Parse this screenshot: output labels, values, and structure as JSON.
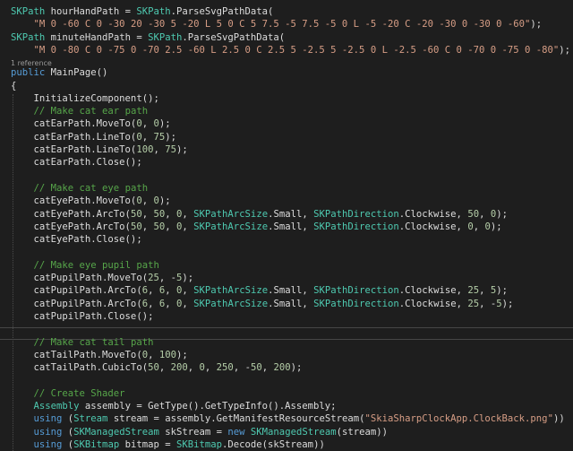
{
  "colors": {
    "background": "#1e1e1e",
    "text": "#dcdcdc",
    "type": "#4ec9b0",
    "keyword": "#569cd6",
    "string": "#d69d85",
    "comment": "#57a64a",
    "number": "#b5cea8"
  },
  "lines": [
    [
      [
        "t",
        "SKPath"
      ],
      [
        "p",
        " hourHandPath = "
      ],
      [
        "t",
        "SKPath"
      ],
      [
        "p",
        ".ParseSvgPathData("
      ]
    ],
    [
      [
        "p",
        "    "
      ],
      [
        "s",
        "\"M 0 -60 C 0 -30 20 -30 5 -20 L 5 0 C 5 7.5 -5 7.5 -5 0 L -5 -20 C -20 -30 0 -30 0 -60\""
      ],
      [
        "p",
        ");"
      ]
    ],
    [
      [
        "t",
        "SKPath"
      ],
      [
        "p",
        " minuteHandPath = "
      ],
      [
        "t",
        "SKPath"
      ],
      [
        "p",
        ".ParseSvgPathData("
      ]
    ],
    [
      [
        "p",
        "    "
      ],
      [
        "s",
        "\"M 0 -80 C 0 -75 0 -70 2.5 -60 L 2.5 0 C 2.5 5 -2.5 5 -2.5 0 L -2.5 -60 C 0 -70 0 -75 0 -80\""
      ],
      [
        "p",
        ");"
      ]
    ],
    [
      [
        "lens",
        "1 reference"
      ]
    ],
    [
      [
        "k",
        "public"
      ],
      [
        "p",
        " MainPage()"
      ]
    ],
    [
      [
        "p",
        "{"
      ]
    ],
    [
      [
        "p",
        "    InitializeComponent();"
      ]
    ],
    [
      [
        "p",
        "    "
      ],
      [
        "c",
        "// Make cat ear path"
      ]
    ],
    [
      [
        "p",
        "    catEarPath.MoveTo("
      ],
      [
        "n",
        "0"
      ],
      [
        "p",
        ", "
      ],
      [
        "n",
        "0"
      ],
      [
        "p",
        ");"
      ]
    ],
    [
      [
        "p",
        "    catEarPath.LineTo("
      ],
      [
        "n",
        "0"
      ],
      [
        "p",
        ", "
      ],
      [
        "n",
        "75"
      ],
      [
        "p",
        ");"
      ]
    ],
    [
      [
        "p",
        "    catEarPath.LineTo("
      ],
      [
        "n",
        "100"
      ],
      [
        "p",
        ", "
      ],
      [
        "n",
        "75"
      ],
      [
        "p",
        ");"
      ]
    ],
    [
      [
        "p",
        "    catEarPath.Close();"
      ]
    ],
    [
      [
        "p",
        ""
      ]
    ],
    [
      [
        "p",
        "    "
      ],
      [
        "c",
        "// Make cat eye path"
      ]
    ],
    [
      [
        "p",
        "    catEyePath.MoveTo("
      ],
      [
        "n",
        "0"
      ],
      [
        "p",
        ", "
      ],
      [
        "n",
        "0"
      ],
      [
        "p",
        ");"
      ]
    ],
    [
      [
        "p",
        "    catEyePath.ArcTo("
      ],
      [
        "n",
        "50"
      ],
      [
        "p",
        ", "
      ],
      [
        "n",
        "50"
      ],
      [
        "p",
        ", "
      ],
      [
        "n",
        "0"
      ],
      [
        "p",
        ", "
      ],
      [
        "t",
        "SKPathArcSize"
      ],
      [
        "p",
        ".Small, "
      ],
      [
        "t",
        "SKPathDirection"
      ],
      [
        "p",
        ".Clockwise, "
      ],
      [
        "n",
        "50"
      ],
      [
        "p",
        ", "
      ],
      [
        "n",
        "0"
      ],
      [
        "p",
        ");"
      ]
    ],
    [
      [
        "p",
        "    catEyePath.ArcTo("
      ],
      [
        "n",
        "50"
      ],
      [
        "p",
        ", "
      ],
      [
        "n",
        "50"
      ],
      [
        "p",
        ", "
      ],
      [
        "n",
        "0"
      ],
      [
        "p",
        ", "
      ],
      [
        "t",
        "SKPathArcSize"
      ],
      [
        "p",
        ".Small, "
      ],
      [
        "t",
        "SKPathDirection"
      ],
      [
        "p",
        ".Clockwise, "
      ],
      [
        "n",
        "0"
      ],
      [
        "p",
        ", "
      ],
      [
        "n",
        "0"
      ],
      [
        "p",
        ");"
      ]
    ],
    [
      [
        "p",
        "    catEyePath.Close();"
      ]
    ],
    [
      [
        "p",
        ""
      ]
    ],
    [
      [
        "p",
        "    "
      ],
      [
        "c",
        "// Make eye pupil path"
      ]
    ],
    [
      [
        "p",
        "    catPupilPath.MoveTo("
      ],
      [
        "n",
        "25"
      ],
      [
        "p",
        ", -"
      ],
      [
        "n",
        "5"
      ],
      [
        "p",
        ");"
      ]
    ],
    [
      [
        "p",
        "    catPupilPath.ArcTo("
      ],
      [
        "n",
        "6"
      ],
      [
        "p",
        ", "
      ],
      [
        "n",
        "6"
      ],
      [
        "p",
        ", "
      ],
      [
        "n",
        "0"
      ],
      [
        "p",
        ", "
      ],
      [
        "t",
        "SKPathArcSize"
      ],
      [
        "p",
        ".Small, "
      ],
      [
        "t",
        "SKPathDirection"
      ],
      [
        "p",
        ".Clockwise, "
      ],
      [
        "n",
        "25"
      ],
      [
        "p",
        ", "
      ],
      [
        "n",
        "5"
      ],
      [
        "p",
        ");"
      ]
    ],
    [
      [
        "p",
        "    catPupilPath.ArcTo("
      ],
      [
        "n",
        "6"
      ],
      [
        "p",
        ", "
      ],
      [
        "n",
        "6"
      ],
      [
        "p",
        ", "
      ],
      [
        "n",
        "0"
      ],
      [
        "p",
        ", "
      ],
      [
        "t",
        "SKPathArcSize"
      ],
      [
        "p",
        ".Small, "
      ],
      [
        "t",
        "SKPathDirection"
      ],
      [
        "p",
        ".Clockwise, "
      ],
      [
        "n",
        "25"
      ],
      [
        "p",
        ", -"
      ],
      [
        "n",
        "5"
      ],
      [
        "p",
        ");"
      ]
    ],
    [
      [
        "p",
        "    catPupilPath.Close();"
      ]
    ],
    [
      [
        "p",
        ""
      ]
    ],
    [
      [
        "p",
        "    "
      ],
      [
        "c",
        "// Make cat tail path"
      ]
    ],
    [
      [
        "p",
        "    catTailPath.MoveTo("
      ],
      [
        "n",
        "0"
      ],
      [
        "p",
        ", "
      ],
      [
        "n",
        "100"
      ],
      [
        "p",
        ");"
      ]
    ],
    [
      [
        "p",
        "    catTailPath.CubicTo("
      ],
      [
        "n",
        "50"
      ],
      [
        "p",
        ", "
      ],
      [
        "n",
        "200"
      ],
      [
        "p",
        ", "
      ],
      [
        "n",
        "0"
      ],
      [
        "p",
        ", "
      ],
      [
        "n",
        "250"
      ],
      [
        "p",
        ", -"
      ],
      [
        "n",
        "50"
      ],
      [
        "p",
        ", "
      ],
      [
        "n",
        "200"
      ],
      [
        "p",
        ");"
      ]
    ],
    [
      [
        "p",
        ""
      ]
    ],
    [
      [
        "p",
        "    "
      ],
      [
        "c",
        "// Create Shader"
      ]
    ],
    [
      [
        "p",
        "    "
      ],
      [
        "t",
        "Assembly"
      ],
      [
        "p",
        " assembly = GetType().GetTypeInfo().Assembly;"
      ]
    ],
    [
      [
        "p",
        "    "
      ],
      [
        "k",
        "using"
      ],
      [
        "p",
        " ("
      ],
      [
        "t",
        "Stream"
      ],
      [
        "p",
        " stream = assembly.GetManifestResourceStream("
      ],
      [
        "s",
        "\"SkiaSharpClockApp.ClockBack.png\""
      ],
      [
        "p",
        "))"
      ]
    ],
    [
      [
        "p",
        "    "
      ],
      [
        "k",
        "using"
      ],
      [
        "p",
        " ("
      ],
      [
        "t",
        "SKManagedStream"
      ],
      [
        "p",
        " skStream = "
      ],
      [
        "k",
        "new"
      ],
      [
        "p",
        " "
      ],
      [
        "t",
        "SKManagedStream"
      ],
      [
        "p",
        "(stream))"
      ]
    ],
    [
      [
        "p",
        "    "
      ],
      [
        "k",
        "using"
      ],
      [
        "p",
        " ("
      ],
      [
        "t",
        "SKBitmap"
      ],
      [
        "p",
        " bitmap = "
      ],
      [
        "t",
        "SKBitmap"
      ],
      [
        "p",
        ".Decode(skStream))"
      ]
    ]
  ]
}
